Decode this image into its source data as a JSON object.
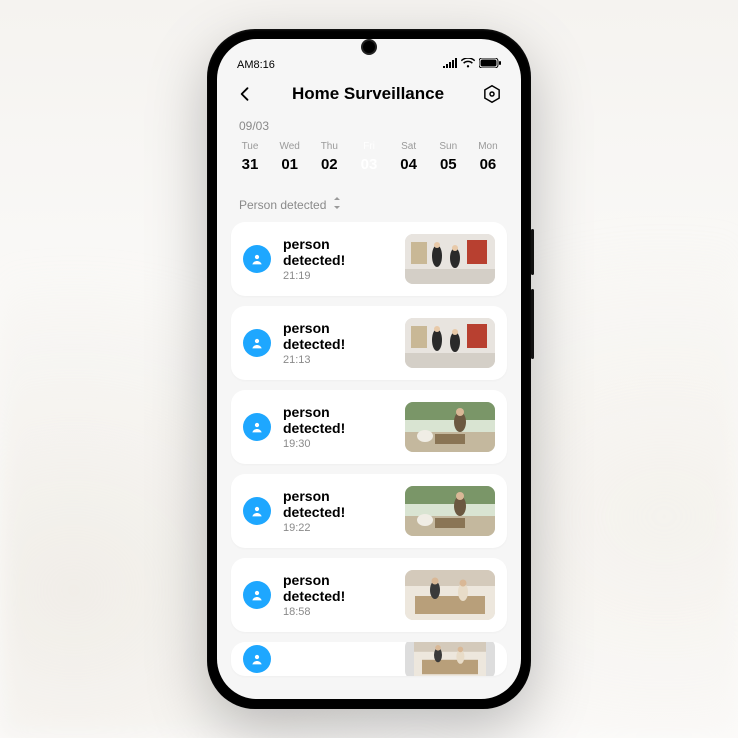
{
  "status": {
    "time": "AM8:16"
  },
  "header": {
    "title": "Home  Surveillance"
  },
  "date_label": "09/03",
  "days": [
    {
      "dow": "Tue",
      "num": "31",
      "selected": false
    },
    {
      "dow": "Wed",
      "num": "01",
      "selected": false
    },
    {
      "dow": "Thu",
      "num": "02",
      "selected": false
    },
    {
      "dow": "Fri",
      "num": "03",
      "selected": true
    },
    {
      "dow": "Sat",
      "num": "04",
      "selected": false
    },
    {
      "dow": "Sun",
      "num": "05",
      "selected": false
    },
    {
      "dow": "Mon",
      "num": "06",
      "selected": false
    }
  ],
  "filter": {
    "label": "Person detected"
  },
  "events": [
    {
      "title": "person detected!",
      "time": "21:19",
      "thumb": "scene-a"
    },
    {
      "title": "person detected!",
      "time": "21:13",
      "thumb": "scene-a"
    },
    {
      "title": "person detected!",
      "time": "19:30",
      "thumb": "scene-b"
    },
    {
      "title": "person detected!",
      "time": "19:22",
      "thumb": "scene-b"
    },
    {
      "title": "person detected!",
      "time": "18:58",
      "thumb": "scene-c"
    }
  ]
}
